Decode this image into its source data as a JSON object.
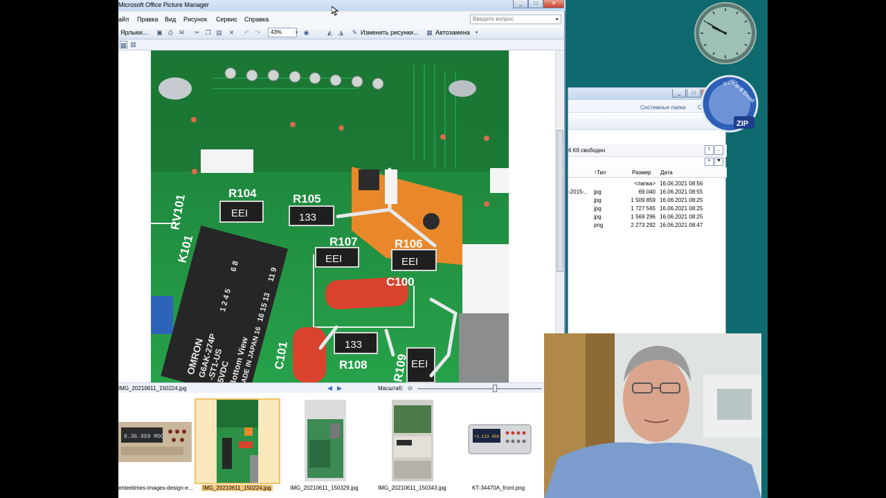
{
  "app": {
    "title": "Microsoft Office Picture Manager",
    "window_buttons": [
      "_",
      "□",
      "×"
    ],
    "menu": [
      "айл",
      "Правка",
      "Вид",
      "Рисунок",
      "Сервис",
      "Справка"
    ],
    "ask_placeholder": "Введите вопрос",
    "toolbar": {
      "shortcuts": "Ярлыки...",
      "zoom": "43%",
      "edit_pictures": "Изменить рисунки...",
      "autocorrect": "Автозамена"
    },
    "status": {
      "filename": "IMG_20210611_150224.jpg",
      "scale_label": "Масштаб:",
      "zoom_fraction": 0.62
    },
    "filmstrip": [
      {
        "caption": "enteetimes-images-design-e...",
        "selected": false
      },
      {
        "caption": "IMG_20210611_150224.jpg",
        "selected": true
      },
      {
        "caption": "IMG_20210611_150329.jpg",
        "selected": false
      },
      {
        "caption": "IMG_20210611_150343.jpg",
        "selected": false
      },
      {
        "caption": "KT-34470A_front.png",
        "selected": false
      }
    ],
    "thumb_texts": {
      "meter_small": "0.36.959 MOC",
      "meter_big": "+1.123 456 8"
    }
  },
  "photo": {
    "labels": [
      "R104",
      "R105",
      "RV101",
      "R107",
      "R106",
      "C100",
      "K101",
      "C101",
      "R108",
      "R109"
    ],
    "resistor_codes": [
      "EEI",
      "133",
      "EEI",
      "EEI",
      "133",
      "EEI"
    ],
    "relay_lines": [
      "OMRON",
      "G6AK-274P",
      "-ST1-US",
      "5VDC",
      "Bottom View",
      "MADE IN JAPAN 16"
    ],
    "relay_pins": [
      "1 2 4 5",
      "16 15 13",
      "6 8",
      "11 9"
    ]
  },
  "explorer": {
    "window_buttons": [
      "_",
      "□",
      "×"
    ],
    "menu": [
      "Системные папки",
      "Справка"
    ],
    "free_space": "6 Кб свободно",
    "columns": [
      "↑Тип",
      "Размер",
      "Дата"
    ],
    "rows": [
      {
        "name": "",
        "type": "",
        "size": "<папка>",
        "date": "16.06.2021 08:56"
      },
      {
        "name": "-2015-..",
        "type": "jpg",
        "size": "69 040",
        "date": "16.06.2021 08:55"
      },
      {
        "name": "",
        "type": "jpg",
        "size": "1 509 859",
        "date": "16.06.2021 08:25"
      },
      {
        "name": "",
        "type": "jpg",
        "size": "1 727 565",
        "date": "16.06.2021 08:25"
      },
      {
        "name": "",
        "type": "jpg",
        "size": "1 569 296",
        "date": "16.06.2021 08:25"
      },
      {
        "name": "",
        "type": "png",
        "size": "2 273 292",
        "date": "16.06.2021 08:47"
      }
    ]
  },
  "gadgets": {
    "clock": {
      "hour": 9,
      "minute": 50
    },
    "zip_email": {
      "title": "Zip & Email",
      "small": "inzip",
      "badge": "ZIP"
    }
  },
  "colors": {
    "desktop": "#0e6a6e",
    "pcb_green": "#1d8a3a",
    "selection": "#f8c87a"
  }
}
